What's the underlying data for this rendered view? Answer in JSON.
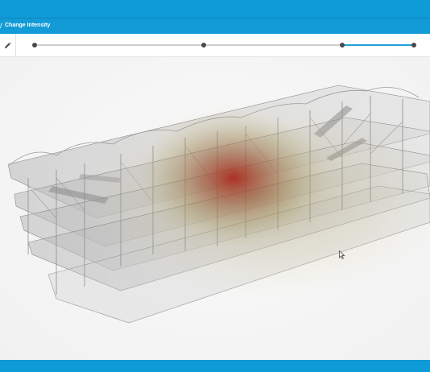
{
  "header": {
    "breadcrumb_sep": "/",
    "title": "Change Intensity"
  },
  "toolbar": {
    "edit_icon": "pencil-icon"
  },
  "timeline": {
    "markers": [
      0,
      0.445,
      0.81,
      1
    ],
    "selected_range": [
      0.81,
      1
    ],
    "active_color": "#1ea0da"
  },
  "colors": {
    "brand": "#0f9ad8",
    "heat_hot": "#b01e10",
    "heat_mid": "#a2884a",
    "heat_low": "#c9c08a"
  }
}
